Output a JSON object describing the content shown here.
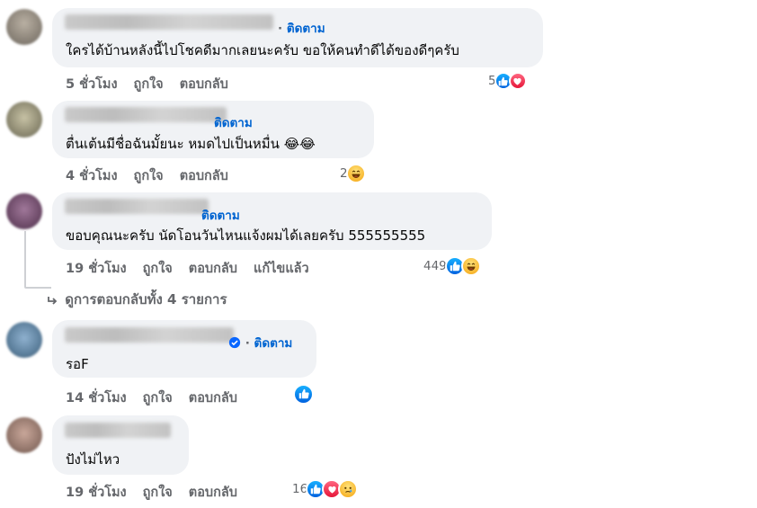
{
  "comments": [
    {
      "text": "ใครได้บ้านหลังนี้ไปโชคดีมากเลยนะครับ ขอให้คนทำดีได้ของดีๆครับ",
      "follow": "ติดตาม",
      "time": "5 ชั่วโมง",
      "like": "ถูกใจ",
      "reply": "ตอบกลับ",
      "reaction_count": "5",
      "reactions": [
        "like-icon",
        "love-icon"
      ]
    },
    {
      "text": "ตื่นเต้นมีชื่อฉันมั้ยนะ หมดไปเป็นหมื่น 😂😂",
      "follow": "ติดตาม",
      "time": "4 ชั่วโมง",
      "like": "ถูกใจ",
      "reply": "ตอบกลับ",
      "reaction_count": "2",
      "reactions": [
        "haha-icon"
      ]
    },
    {
      "text": "ขอบคุณนะครับ นัดโอนวันไหนแจ้งผมได้เลยครับ 555555555",
      "follow": "ติดตาม",
      "time": "19 ชั่วโมง",
      "like": "ถูกใจ",
      "reply": "ตอบกลับ",
      "edited": "แก้ไขแล้ว",
      "reaction_count": "449",
      "reactions": [
        "like-icon",
        "haha-icon"
      ]
    }
  ],
  "view_replies": "ดูการตอบกลับทั้ง 4 รายการ",
  "replies": [
    {
      "text": "รอF",
      "follow": "ติดตาม",
      "time": "14 ชั่วโมง",
      "like": "ถูกใจ",
      "reply": "ตอบกลับ",
      "reaction_count": "",
      "reactions": [
        "like-icon"
      ]
    },
    {
      "text": "ปังไม่ไหว",
      "time": "19 ชั่วโมง",
      "like": "ถูกใจ",
      "reply": "ตอบกลับ",
      "reaction_count": "16",
      "reactions": [
        "like-icon",
        "love-icon",
        "sad-icon"
      ]
    }
  ],
  "colors": {
    "bubble": "#f0f2f5",
    "follow": "#0064d1",
    "meta": "#65676b",
    "like": "#0866ff",
    "love": "#f33e58"
  }
}
